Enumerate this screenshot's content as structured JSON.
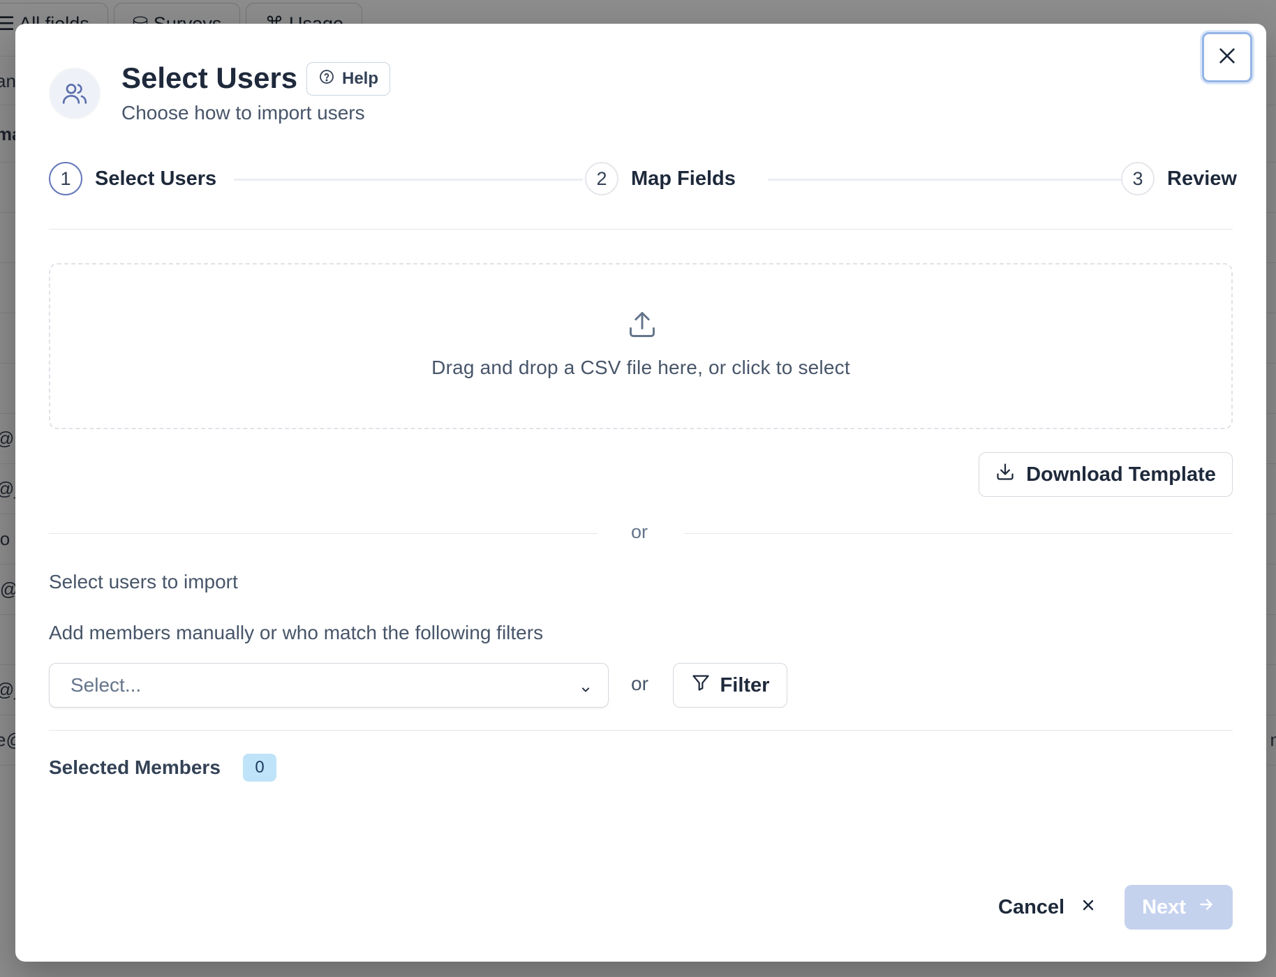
{
  "background": {
    "tabs": [
      "All fields",
      "Surveys",
      "Usage"
    ],
    "rows": [
      {
        "text": "an"
      },
      {
        "text": "ma"
      },
      {
        "text": "@p"
      },
      {
        "text": "@j"
      },
      {
        "text": "jo"
      },
      {
        "text": "i@"
      },
      {
        "text": "@j"
      },
      {
        "text": "e@",
        "right": "n"
      }
    ]
  },
  "modal": {
    "title": "Select Users",
    "help_label": "Help",
    "subtitle": "Choose how to import users",
    "steps": [
      {
        "number": "1",
        "label": "Select Users"
      },
      {
        "number": "2",
        "label": "Map Fields"
      },
      {
        "number": "3",
        "label": "Review"
      }
    ],
    "dropzone_text": "Drag and drop a CSV file here, or click to select",
    "download_template_label": "Download Template",
    "or_text": "or",
    "section_label": "Select users to import",
    "filter_description": "Add members manually or who match the following filters",
    "select_placeholder": "Select...",
    "or_text_2": "or",
    "filter_label": "Filter",
    "selected_members_label": "Selected Members",
    "selected_members_count": "0",
    "cancel_label": "Cancel",
    "next_label": "Next"
  },
  "colors": {
    "accent_step": "#6478b8",
    "next_disabled": "#c5d2ee",
    "badge_bg": "#bfe3f8"
  }
}
